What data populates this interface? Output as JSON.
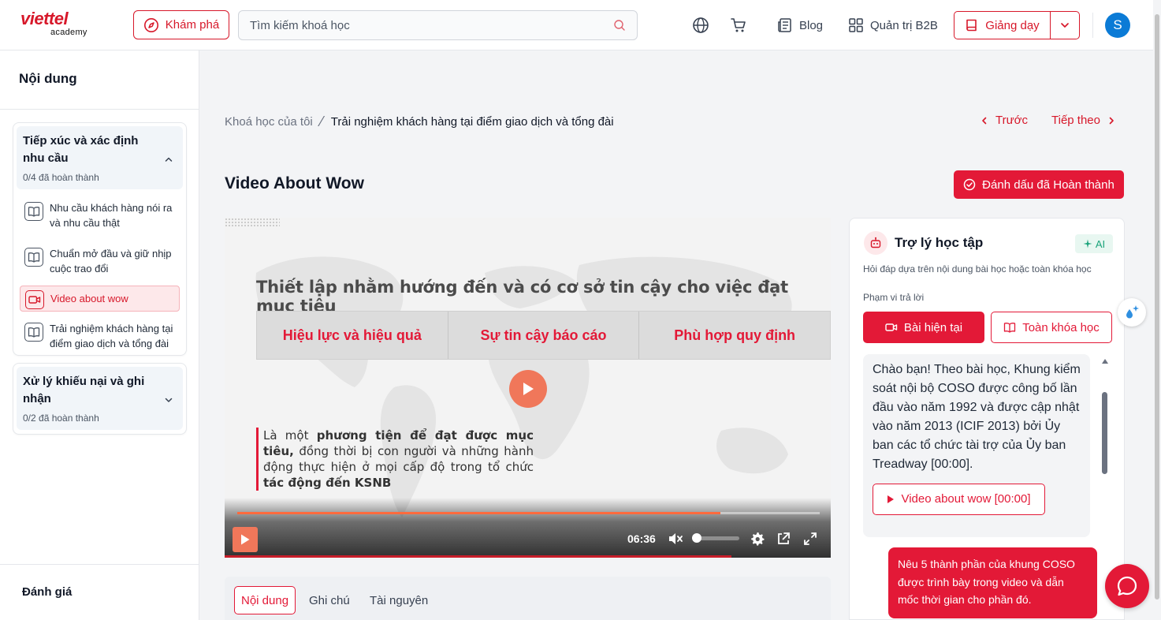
{
  "header": {
    "logo_main": "viettel",
    "logo_sub": "academy",
    "explore_label": "Khám phá",
    "search_placeholder": "Tìm kiếm khoá học",
    "blog_label": "Blog",
    "b2b_label": "Quản trị B2B",
    "teach_label": "Giảng dạy",
    "avatar_letter": "S"
  },
  "sidebar": {
    "title": "Nội dung",
    "sections": [
      {
        "title": "Tiếp xúc và xác định nhu cầu",
        "progress": "0/4 đã hoàn thành",
        "expanded": true,
        "lessons": [
          {
            "label": "Nhu cầu khách hàng nói ra và nhu cầu thật",
            "icon": "book-icon",
            "active": false
          },
          {
            "label": "Chuẩn mở đầu và giữ nhịp cuộc trao đổi",
            "icon": "book-icon",
            "active": false
          },
          {
            "label": "Video about wow",
            "icon": "video-icon",
            "active": true
          },
          {
            "label": "Trải nghiệm khách hàng tại điểm giao dịch và tổng đài",
            "icon": "book-icon",
            "active": false
          }
        ]
      },
      {
        "title": "Xử lý khiếu nại và ghi nhận",
        "progress": "0/2 đã hoàn thành",
        "expanded": false,
        "lessons": []
      }
    ],
    "footer": "Đánh giá"
  },
  "breadcrumb": {
    "parent": "Khoá học của tôi",
    "current": "Trải nghiệm khách hàng tại điểm giao dịch và tổng đài"
  },
  "nav": {
    "prev": "Trước",
    "next": "Tiếp theo"
  },
  "lesson": {
    "title": "Video About Wow",
    "complete_label": "Đánh dấu đã Hoàn thành"
  },
  "video": {
    "slide_title": "Thiết lập nhằm hướng đến và có cơ sở tin cậy cho việc đạt mục tiêu",
    "boxes": [
      "Hiệu lực và hiệu quả",
      "Sự tin cậy báo cáo",
      "Phù hợp quy định"
    ],
    "quote_part1": "Là một ",
    "quote_bold1": "phương tiện để đạt được mục tiêu,",
    "quote_part2": " đồng thời bị con người và những hành động thực hiện ở mọi cấp độ trong tổ chức ",
    "quote_bold2": "tác động đến KSNB",
    "time": "06:36",
    "progress": 0.83,
    "volume": 0.0,
    "colors": {
      "accent": "#f0775a",
      "progress": "#ff6a3d"
    }
  },
  "tabs": [
    {
      "label": "Nội dung",
      "active": true
    },
    {
      "label": "Ghi chú",
      "active": false
    },
    {
      "label": "Tài nguyên",
      "active": false
    }
  ],
  "assistant": {
    "title": "Trợ lý học tập",
    "badge": "AI",
    "description": "Hỏi đáp dựa trên nội dung bài học hoặc toàn khóa học",
    "scope_label": "Phạm vi trả lời",
    "btn_current": "Bài hiện tại",
    "btn_all": "Toàn khóa học",
    "bot_message": "Chào bạn! Theo bài học, Khung kiểm soát nội bộ COSO được công bố lần đầu vào năm 1992 và được cập nhật vào năm 2013 (ICIF 2013) bởi Ủy ban các tổ chức tài trợ của Ủy ban Treadway [00:00].",
    "bot_link": "Video about wow [00:00]",
    "user_message": "Nêu 5 thành phần của khung COSO được trình bày trong video và dẫn mốc thời gian cho phần đó."
  },
  "colors": {
    "brand": "#d7182a",
    "primary_button": "#e31937",
    "ai_badge": "#1aa37a"
  }
}
